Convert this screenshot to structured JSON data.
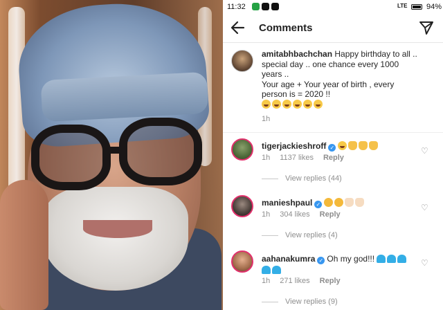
{
  "status_bar": {
    "time": "11:32",
    "network": "LTE",
    "battery": "94%"
  },
  "header": {
    "title": "Comments"
  },
  "caption": {
    "username": "amitabhbachchan",
    "text_line1": "Happy birthday to all ..",
    "text_line2": "special day .. one chance every 1000",
    "text_line3": "years ..",
    "text_line4": "Your age + Your year of birth , every",
    "text_line5": "person is = 2020 !!",
    "time": "1h"
  },
  "comments": [
    {
      "username": "tigerjackieshroff",
      "time": "1h",
      "likes": "1137 likes",
      "reply": "Reply",
      "view_replies": "View replies (44)"
    },
    {
      "username": "manieshpaul",
      "time": "1h",
      "likes": "304 likes",
      "reply": "Reply",
      "view_replies": "View replies (4)"
    },
    {
      "username": "aahanakumra",
      "text": "Oh my god!!!",
      "time": "1h",
      "likes": "271 likes",
      "reply": "Reply",
      "view_replies": "View replies (9)"
    }
  ],
  "icons": {
    "back": "arrow-left-icon",
    "send": "paper-plane-icon",
    "like": "heart-outline-icon"
  }
}
